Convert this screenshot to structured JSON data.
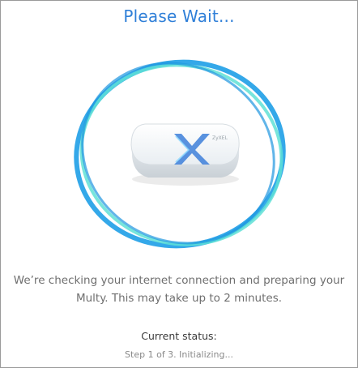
{
  "dialog": {
    "title": "Please Wait...",
    "message_line1": "We’re checking your internet connection and preparing your",
    "message_line2": "Multy. This may take up to 2 minutes.",
    "status_label": "Current status:",
    "status_value": "Step 1 of 3. Initializing...",
    "device_logo": "ZyXEL"
  },
  "colors": {
    "title": "#2f7fd8",
    "ring_primary": "#29a3e8",
    "ring_secondary": "#5fe0d6",
    "message": "#6f6f6f"
  },
  "icons": {
    "spinner": "spinner-ring-icon",
    "device": "router-device-icon"
  }
}
